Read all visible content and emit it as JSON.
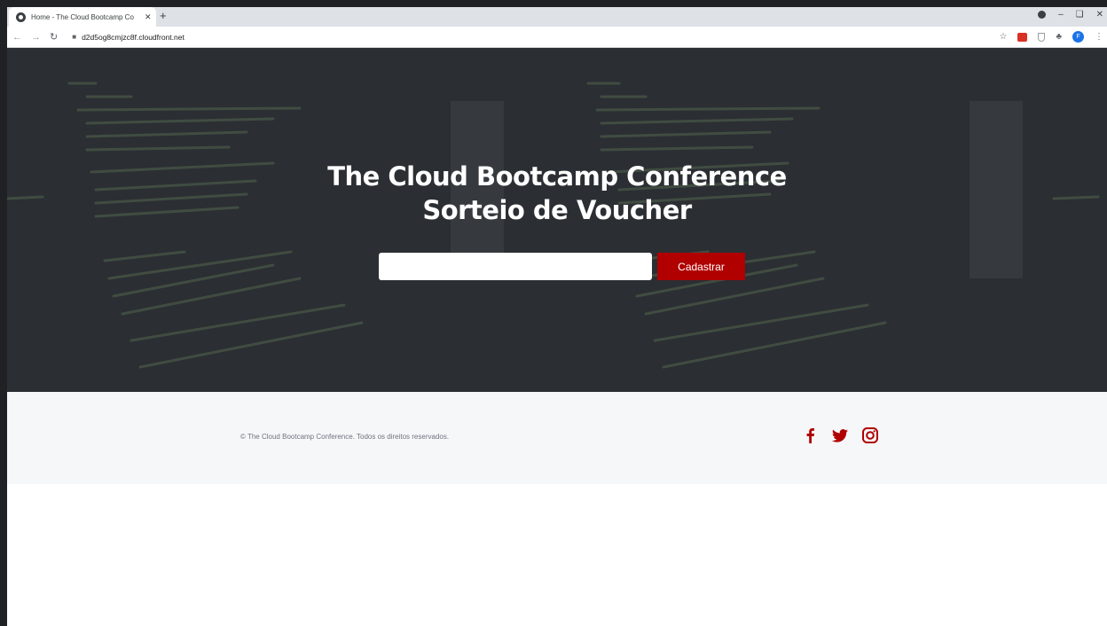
{
  "browser": {
    "tab_title": "Home - The Cloud Bootcamp Co",
    "tab_close": "✕",
    "new_tab": "+",
    "url": "d2d5og8cmjzc8f.cloudfront.net",
    "avatar_letter": "F"
  },
  "hero": {
    "title_line1": "The Cloud Bootcamp Conference",
    "title_line2": "Sorteio de Voucher",
    "input_value": "",
    "input_placeholder": "",
    "submit_label": "Cadastrar"
  },
  "footer": {
    "copyright": "© The Cloud Bootcamp Conference. Todos os direitos reservados.",
    "socials": [
      "facebook-icon",
      "twitter-icon",
      "instagram-icon"
    ]
  },
  "colors": {
    "accent": "#b00000",
    "hero_bg": "#2b2e33",
    "footer_bg": "#f6f7f9"
  }
}
